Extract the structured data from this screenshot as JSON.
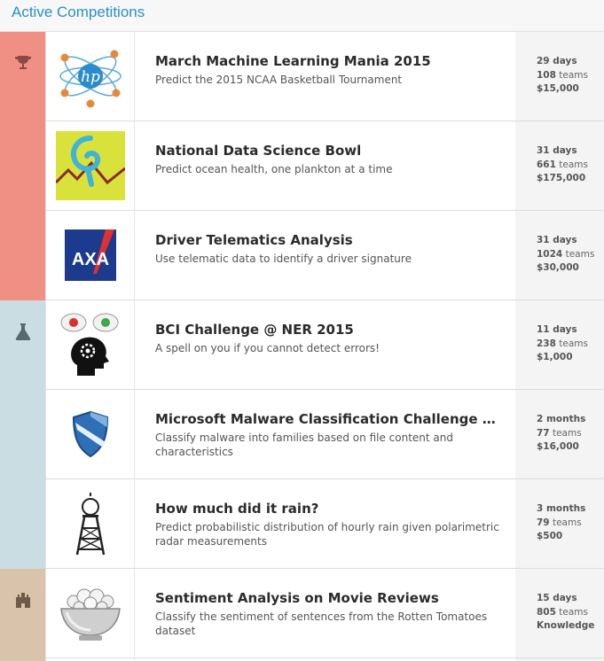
{
  "header": {
    "title": "Active Competitions"
  },
  "colors": {
    "featured": "#f08f84",
    "research": "#c9dde2",
    "playground": "#d9c3ab",
    "link": "#2a8fc7"
  },
  "competitions": [
    {
      "category_icon": "trophy-icon",
      "thumb_icon": "hp-atom-basketball-logo",
      "title": "March Machine Learning Mania 2015",
      "description": "Predict the 2015 NCAA Basketball Tournament",
      "time": "29 days",
      "teams_count": "108",
      "teams_label": "teams",
      "prize": "$15,000"
    },
    {
      "category_icon": "trophy-icon",
      "thumb_icon": "ocean-swirl-logo",
      "title": "National Data Science Bowl",
      "description": "Predict ocean health, one plankton at a time",
      "time": "31 days",
      "teams_count": "661",
      "teams_label": "teams",
      "prize": "$175,000"
    },
    {
      "category_icon": "trophy-icon",
      "thumb_icon": "axa-logo",
      "logo_text": "AXA",
      "title": "Driver Telematics Analysis",
      "description": "Use telematic data to identify a driver signature",
      "time": "31 days",
      "teams_count": "1024",
      "teams_label": "teams",
      "prize": "$30,000"
    },
    {
      "category_icon": "flask-icon",
      "thumb_icon": "brain-head-logo",
      "title": "BCI Challenge @ NER 2015",
      "description": "A spell on you if you cannot detect errors!",
      "time": "11 days",
      "teams_count": "238",
      "teams_label": "teams",
      "prize": "$1,000"
    },
    {
      "category_icon": "flask-icon",
      "thumb_icon": "shield-logo",
      "title": "Microsoft Malware Classification Challenge (B…",
      "description": "Classify malware into families based on file content and characteristics",
      "time": "2 months",
      "teams_count": "77",
      "teams_label": "teams",
      "prize": "$16,000"
    },
    {
      "category_icon": "flask-icon",
      "thumb_icon": "radar-tower-logo",
      "title": "How much did it rain?",
      "description": "Predict probabilistic distribution of hourly rain given polarimetric radar measurements",
      "time": "3 months",
      "teams_count": "79",
      "teams_label": "teams",
      "prize": "$500"
    },
    {
      "category_icon": "castle-icon",
      "thumb_icon": "popcorn-bowl-logo",
      "title": "Sentiment Analysis on Movie Reviews",
      "description": "Classify the sentiment of sentences from the Rotten Tomatoes dataset",
      "time": "15 days",
      "teams_count": "805",
      "teams_label": "teams",
      "prize": "Knowledge"
    }
  ]
}
